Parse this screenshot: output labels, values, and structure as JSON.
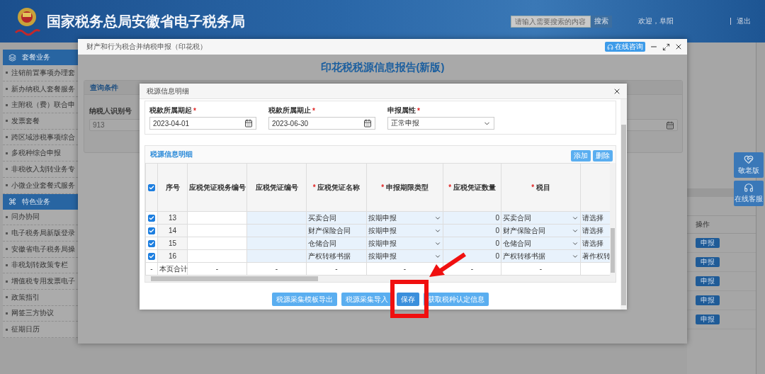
{
  "header": {
    "title": "国家税务总局安徽省电子税务局",
    "search_placeholder": "请输入需要搜索的内容",
    "search_button": "搜索",
    "greeting": "欢迎，阜阳",
    "logout": "退出"
  },
  "sidebar": [
    {
      "title": "套餐业务",
      "items": [
        "注销前置事项办理套",
        "新办纳税人套餐服务",
        "主附税（费）联合申",
        "发票套餐",
        "跨区域涉税事项综合",
        "多税种综合申报",
        "非税收入划转业务专",
        "小微企业套餐式服务"
      ]
    },
    {
      "title": "特色业务",
      "items": [
        "问办协同",
        "电子税务局新版登录",
        "安徽省电子税务局操",
        "非税划转政策专栏",
        "增值税专用发票电子",
        "政策指引",
        "网签三方协议",
        "征期日历"
      ]
    }
  ],
  "background_table": {
    "column": "操作",
    "buttons": [
      "申报",
      "申报",
      "申报",
      "申报",
      "申报"
    ]
  },
  "side_buttons": [
    "敬老版",
    "在线客服"
  ],
  "modal": {
    "title": "财产和行为税合并纳税申报（印花税）",
    "consult_button": "在线咨询",
    "heading": "印花税税源信息报告(新版)",
    "query_panel": {
      "title": "查询条件",
      "field_label": "纳税人识别号",
      "field_value": "913"
    }
  },
  "dialog": {
    "title": "税源信息明细",
    "fields": [
      {
        "kind": "date",
        "label": "税款所属期起",
        "mark": "*",
        "value": "2023-04-01"
      },
      {
        "kind": "date",
        "label": "税款所属期止",
        "mark": "*",
        "value": "2023-06-30"
      },
      {
        "kind": "select",
        "label": "申报属性",
        "mark": "*",
        "value": "正常申报"
      }
    ],
    "section_title": "税源信息明细",
    "section_buttons": [
      "添加",
      "删除"
    ],
    "table": {
      "header_checked": true,
      "columns": [
        {
          "label": "序号"
        },
        {
          "label": "应税凭证税务编号"
        },
        {
          "label": "应税凭证编号"
        },
        {
          "label": "应税凭证名称",
          "mark": "*"
        },
        {
          "label": "申报期限类型",
          "mark": "*"
        },
        {
          "label": "应税凭证数量",
          "mark": "*"
        },
        {
          "label": "税目",
          "mark": "*"
        }
      ],
      "rows": [
        {
          "checked": true,
          "no": "13",
          "name": "买卖合同",
          "period_type": "按期申报",
          "quantity": "0",
          "item": "买卖合同",
          "column_9": "请选择"
        },
        {
          "checked": true,
          "no": "14",
          "name": "财产保险合同",
          "period_type": "按期申报",
          "quantity": "0",
          "item": "财产保险合同",
          "column_9": "请选择"
        },
        {
          "checked": true,
          "no": "15",
          "name": "仓储合同",
          "period_type": "按期申报",
          "quantity": "0",
          "item": "仓储合同",
          "column_9": "请选择"
        },
        {
          "checked": true,
          "no": "16",
          "name": "产权转移书据",
          "period_type": "按期申报",
          "quantity": "0",
          "item": "产权转移书据",
          "column_9": "著作权转"
        }
      ],
      "total_row": {
        "marker": "-",
        "label": "本页合计",
        "cells": [
          "-",
          "-",
          "-",
          "-",
          "-",
          "-"
        ]
      }
    },
    "footer_buttons": [
      {
        "label": "税源采集模板导出",
        "primary": false
      },
      {
        "label": "税源采集导入",
        "primary": false
      },
      {
        "label": "保存",
        "primary": true
      },
      {
        "label": "获取税种认定信息",
        "primary": false
      }
    ]
  }
}
